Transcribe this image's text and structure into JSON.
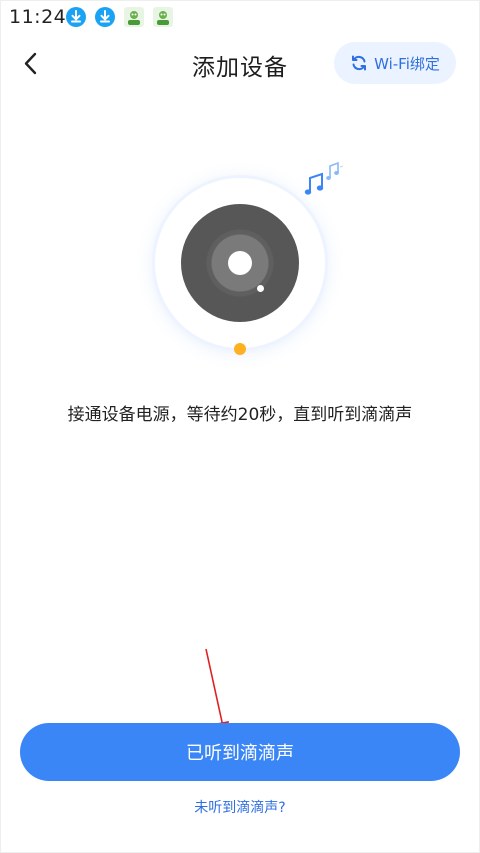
{
  "status_bar": {
    "time": "11:24",
    "icons": [
      "download-icon",
      "download-icon",
      "app-icon",
      "app-icon"
    ]
  },
  "header": {
    "back_icon": "chevron-left-icon",
    "title": "添加设备",
    "wifi_bind_label": "Wi-Fi绑定",
    "wifi_bind_icon": "refresh-icon"
  },
  "illustration": {
    "icons": [
      "disc-icon",
      "music-notes-icon"
    ],
    "accent_color": "#ffb01f"
  },
  "instruction": "接通设备电源，等待约20秒，直到听到滴滴声",
  "primary_button": {
    "label": "已听到滴滴声",
    "color": "#3b86f7"
  },
  "secondary_link": {
    "label": "未听到滴滴声?"
  }
}
